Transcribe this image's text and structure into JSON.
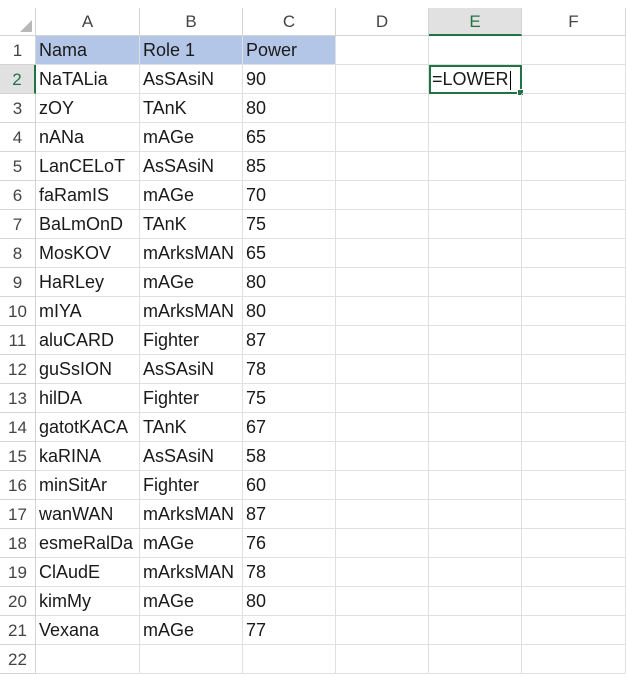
{
  "columns": [
    "A",
    "B",
    "C",
    "D",
    "E",
    "F"
  ],
  "active_column": "E",
  "active_row": "2",
  "header_row": {
    "row": "1",
    "a": "Nama",
    "b": "Role 1",
    "c": "Power"
  },
  "editing_cell": {
    "ref": "E2",
    "value": "=LOWER"
  },
  "rows": [
    {
      "row": "2",
      "a": "NaTALia",
      "b": "AsSAsiN",
      "c": "90"
    },
    {
      "row": "3",
      "a": "zOY",
      "b": "TAnK",
      "c": "80"
    },
    {
      "row": "4",
      "a": "nANa",
      "b": "mAGe",
      "c": "65"
    },
    {
      "row": "5",
      "a": "LanCELoT",
      "b": "AsSAsiN",
      "c": "85"
    },
    {
      "row": "6",
      "a": "faRamIS",
      "b": "mAGe",
      "c": "70"
    },
    {
      "row": "7",
      "a": "BaLmOnD",
      "b": "TAnK",
      "c": "75"
    },
    {
      "row": "8",
      "a": "MosKOV",
      "b": "mArksMAN",
      "c": "65"
    },
    {
      "row": "9",
      "a": "HaRLey",
      "b": "mAGe",
      "c": "80"
    },
    {
      "row": "10",
      "a": "mIYA",
      "b": "mArksMAN",
      "c": "80"
    },
    {
      "row": "11",
      "a": "aluCARD",
      "b": "Fighter",
      "c": "87"
    },
    {
      "row": "12",
      "a": "guSsION",
      "b": "AsSAsiN",
      "c": "78"
    },
    {
      "row": "13",
      "a": "hilDA",
      "b": "Fighter",
      "c": "75"
    },
    {
      "row": "14",
      "a": "gatotKACA",
      "b": "TAnK",
      "c": "67"
    },
    {
      "row": "15",
      "a": "kaRINA",
      "b": "AsSAsiN",
      "c": "58"
    },
    {
      "row": "16",
      "a": "minSitAr",
      "b": "Fighter",
      "c": "60"
    },
    {
      "row": "17",
      "a": "wanWAN",
      "b": "mArksMAN",
      "c": "87"
    },
    {
      "row": "18",
      "a": "esmeRalDa",
      "b": "mAGe",
      "c": "76"
    },
    {
      "row": "19",
      "a": "ClAudE",
      "b": "mArksMAN",
      "c": "78"
    },
    {
      "row": "20",
      "a": "kimMy",
      "b": "mAGe",
      "c": "80"
    },
    {
      "row": "21",
      "a": "Vexana",
      "b": "mAGe",
      "c": "77"
    }
  ],
  "empty_row": {
    "row": "22"
  },
  "colors": {
    "header_fill": "#b4c6e7",
    "accent": "#217346",
    "gridline": "#e0e0e0",
    "header_bg_active": "#e1e1e1"
  },
  "icons": {
    "corner": "select-all-triangle-icon"
  }
}
